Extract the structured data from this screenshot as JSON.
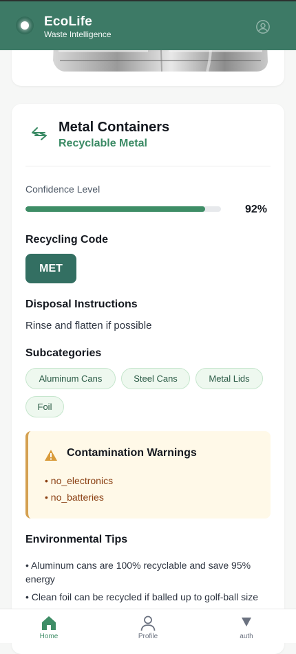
{
  "header": {
    "title": "EcoLife",
    "subtitle": "Waste Intelligence",
    "accent_color": "#3d7a66",
    "logo_icon": "leaf-dot-logo",
    "profile_icon": "user-circle-icon"
  },
  "result": {
    "title": "Metal Containers",
    "category": "Recyclable Metal",
    "category_icon": "recycle-arrows-icon",
    "confidence_label": "Confidence Level",
    "confidence_value": "92%",
    "confidence_fraction": 0.92,
    "recycling_code_heading": "Recycling Code",
    "recycling_code": "MET",
    "disposal_heading": "Disposal Instructions",
    "disposal_text": "Rinse and flatten if possible",
    "subcategories_heading": "Subcategories",
    "subcategories": [
      "Aluminum Cans",
      "Steel Cans",
      "Metal Lids",
      "Foil"
    ],
    "warnings_heading": "Contamination Warnings",
    "warnings": [
      "• no_electronics",
      "• no_batteries"
    ],
    "tips_heading": "Environmental Tips",
    "tips": [
      "• Aluminum cans are 100% recyclable and save 95% energy",
      "• Clean foil can be recycled if balled up to golf-ball size"
    ]
  },
  "nav": {
    "items": [
      {
        "label": "Home",
        "icon": "home-icon",
        "active": true
      },
      {
        "label": "Profile",
        "icon": "user-icon",
        "active": false
      },
      {
        "label": "auth",
        "icon": "triangle-down-icon",
        "active": false
      }
    ],
    "active_color": "#3e8d66",
    "inactive_color": "#6b7280"
  }
}
